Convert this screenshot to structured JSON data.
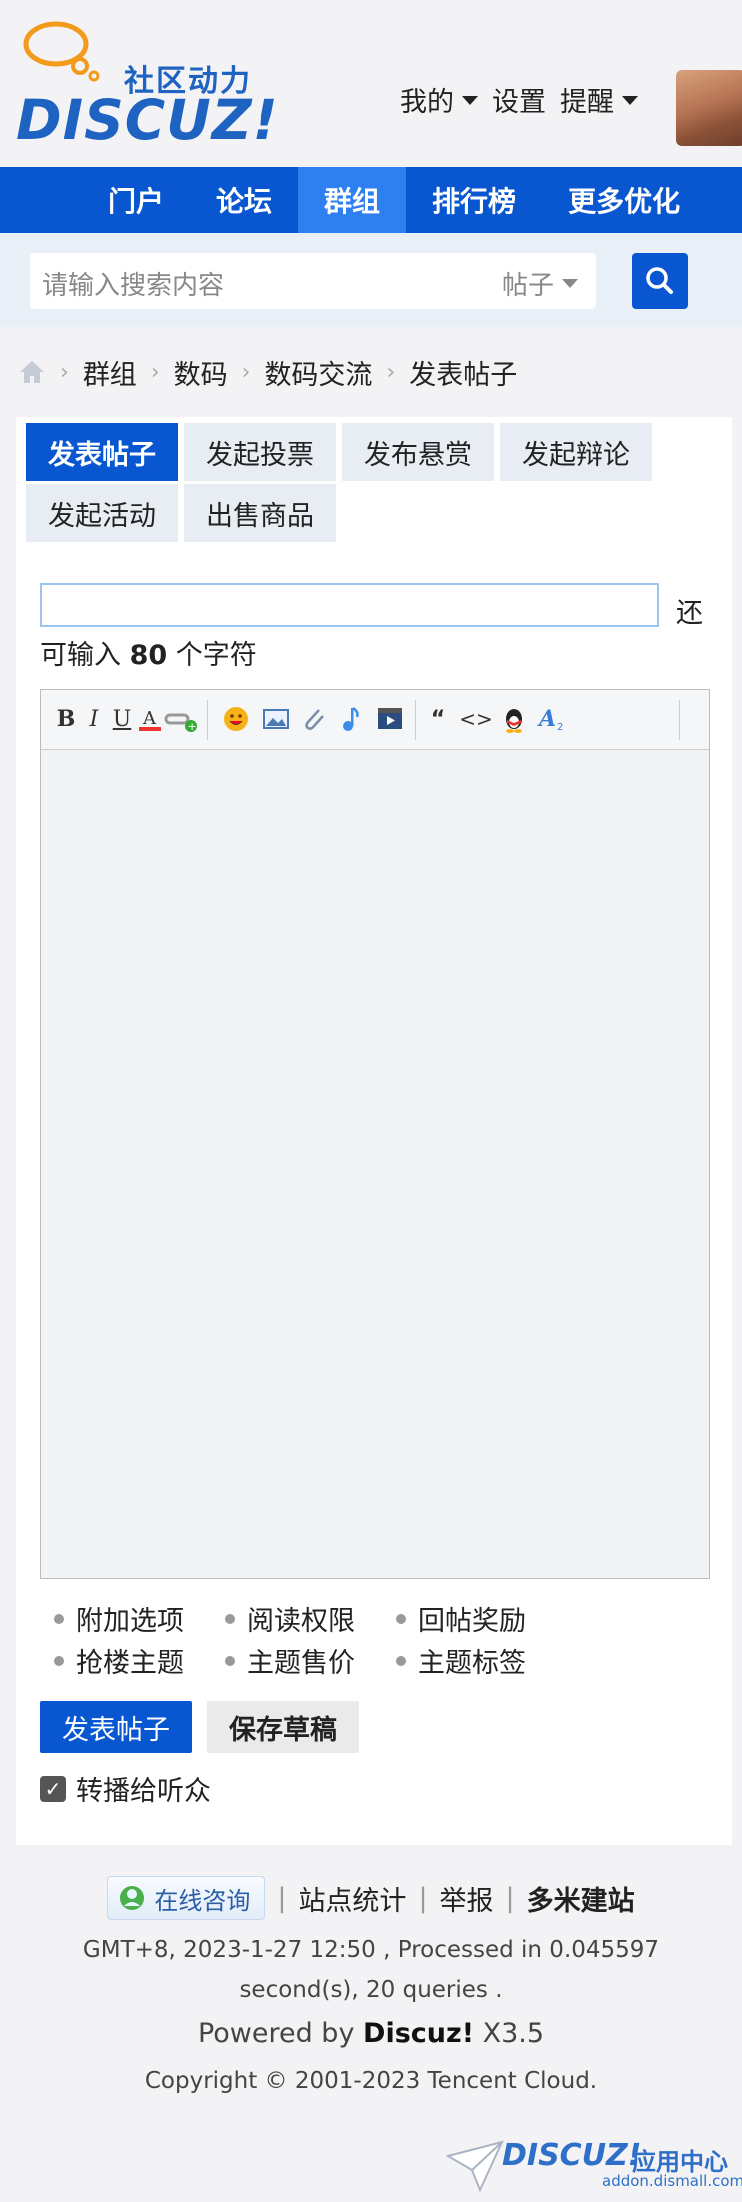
{
  "header": {
    "logo_tagline": "社区动力",
    "logo_word": "DISCUZ!",
    "user_links": [
      {
        "label": "我的",
        "dropdown": true
      },
      {
        "label": "设置",
        "dropdown": false
      },
      {
        "label": "提醒",
        "dropdown": true
      }
    ]
  },
  "nav": {
    "items": [
      {
        "label": "门户",
        "active": false
      },
      {
        "label": "论坛",
        "active": false
      },
      {
        "label": "群组",
        "active": true
      },
      {
        "label": "排行榜",
        "active": false
      },
      {
        "label": "更多优化",
        "active": false
      }
    ]
  },
  "search": {
    "placeholder": "请输入搜索内容",
    "type_label": "帖子"
  },
  "breadcrumb": [
    "群组",
    "数码",
    "数码交流",
    "发表帖子"
  ],
  "post_tabs": [
    {
      "label": "发表帖子",
      "active": true
    },
    {
      "label": "发起投票",
      "active": false
    },
    {
      "label": "发布悬赏",
      "active": false
    },
    {
      "label": "发起辩论",
      "active": false
    },
    {
      "label": "发起活动",
      "active": false
    },
    {
      "label": "出售商品",
      "active": false
    }
  ],
  "subject": {
    "value": "",
    "hint_prefix": "还",
    "hint_line2_prefix": "可输入",
    "remaining": "80",
    "hint_suffix": "个字符"
  },
  "toolbar_icons": [
    "bold-icon",
    "italic-icon",
    "underline-icon",
    "font-color-icon",
    "link-icon",
    "smiley-icon",
    "image-icon",
    "attachment-icon",
    "music-icon",
    "video-icon",
    "quote-icon",
    "code-icon",
    "qq-icon",
    "font-size-icon"
  ],
  "options": [
    "附加选项",
    "阅读权限",
    "回帖奖励",
    "抢楼主题",
    "主题售价",
    "主题标签"
  ],
  "buttons": {
    "post": "发表帖子",
    "draft": "保存草稿"
  },
  "broadcast": {
    "label": "转播给听众",
    "checked": true
  },
  "footer": {
    "consult": "在线咨询",
    "links": [
      "站点统计",
      "举报",
      "多米建站"
    ],
    "info": "GMT+8, 2023-1-27 12:50 , Processed in 0.045597 second(s), 20 queries .",
    "powered_prefix": "Powered by",
    "powered_brand": "Discuz!",
    "powered_version": "X3.5",
    "copyright": "Copyright © 2001-2023 Tencent Cloud.",
    "addon_brand": "DISCUZ!",
    "addon_cn": "应用中心",
    "addon_url": "addon.dismall.com"
  },
  "colors": {
    "primary": "#0957d0",
    "nav_active": "#2e7ff0",
    "logo_blue": "#1e63c2",
    "search_bg": "#eaf0f8"
  }
}
